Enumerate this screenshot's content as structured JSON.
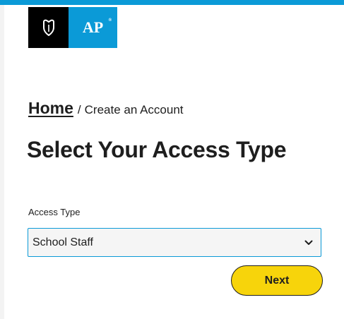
{
  "brand": {
    "logo_text": "AP",
    "logo_registered": "®",
    "logo_icon": "acorn-shield-icon",
    "colors": {
      "accent_blue": "#0b9ad7",
      "logo_black": "#000000",
      "button_yellow": "#f7d40b"
    }
  },
  "breadcrumb": {
    "home_label": "Home",
    "separator": "/",
    "current": "Create an Account"
  },
  "page": {
    "title": "Select Your Access Type"
  },
  "form": {
    "access_type": {
      "label": "Access Type",
      "selected_value": "School Staff",
      "icon": "chevron-down-icon"
    },
    "next_label": "Next"
  }
}
